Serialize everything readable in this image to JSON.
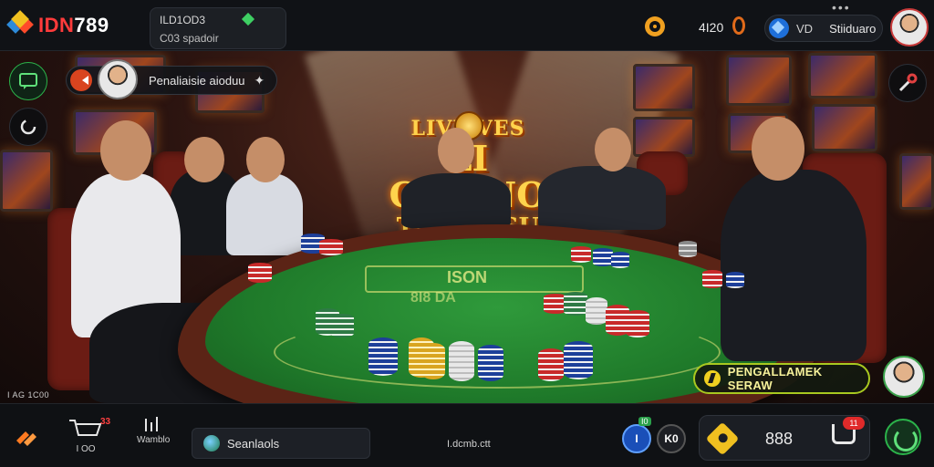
{
  "brand": {
    "name_red": "IDN",
    "name_white": "789"
  },
  "account": {
    "line1": "ILD1OD3",
    "line2": "C03 spadoir"
  },
  "header": {
    "coins": "4I20",
    "user_badge": "VD",
    "username": "Stiiduaro",
    "menu": "•••"
  },
  "scene": {
    "banner": {
      "line1": "LIVE  VES",
      "line2": "LI CASINO",
      "line3": "TERBAISU"
    },
    "table_marking": "ISON",
    "table_odds": "8I8  DA"
  },
  "overlay": {
    "host_pill_text": "Penaliaisie aioduu",
    "stream_label": "I AG 1C00",
    "cta_label": "PENGALLAMEK SERAW"
  },
  "bottombar": {
    "item1_badge": "33",
    "item1_label": "I OO",
    "item2_label": "Wamblo",
    "search_placeholder": "Seanlaols",
    "center_label": "I.dcmb.ctt",
    "chip_left_badge": "I0",
    "chip_left_label": "I",
    "chip_right_label": "K0",
    "balance": "888",
    "cart_badge": "11"
  },
  "colors": {
    "accent_red": "#ff3b3b",
    "cta_border": "#a8c820",
    "refresh_green": "#2bb34a",
    "balance_gold": "#f0c020"
  },
  "icons": [
    "logo-diamond-icon",
    "gem-icon",
    "gear-icon",
    "coin-icon",
    "user-badge-icon",
    "play-icon",
    "trophy-icon",
    "chat-icon",
    "rotate-icon",
    "tools-icon",
    "hand-icon",
    "cart-icon",
    "chart-icon",
    "globe-icon",
    "bolt-icon",
    "tag-icon",
    "refresh-icon"
  ]
}
